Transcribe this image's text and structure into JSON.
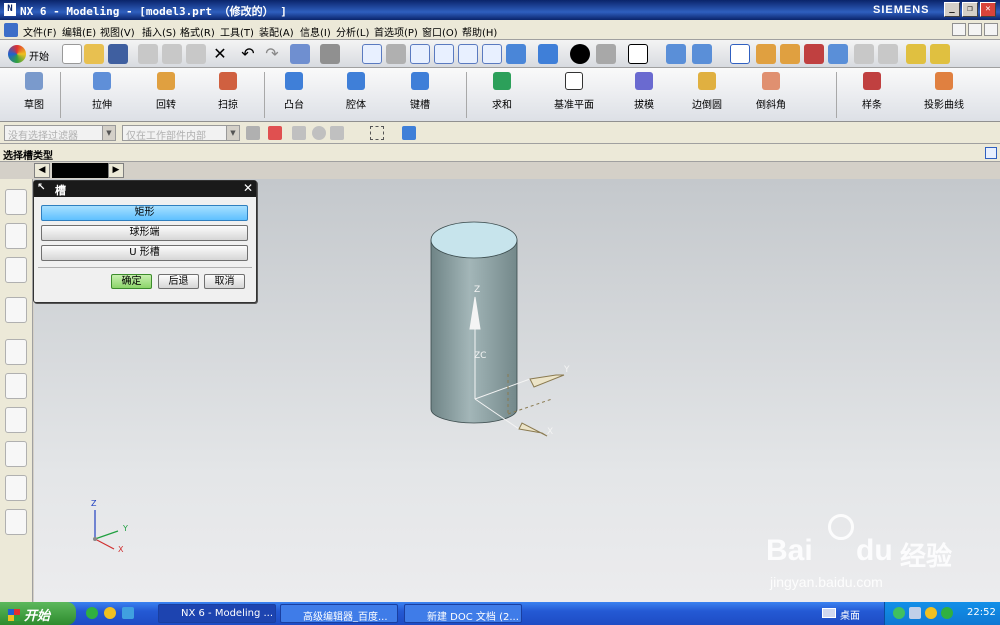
{
  "window": {
    "title": "NX 6 - Modeling - [model3.prt （修改的） ]",
    "brand": "SIEMENS",
    "min": "_",
    "max": "❐",
    "close": "✕"
  },
  "menu": [
    "文件(F)",
    "编辑(E)",
    "视图(V)",
    "插入(S)",
    "格式(R)",
    "工具(T)",
    "装配(A)",
    "信息(I)",
    "分析(L)",
    "首选项(P)",
    "窗口(O)",
    "帮助(H)"
  ],
  "toolbar": {
    "start_label": "开始"
  },
  "features": [
    {
      "label": "草图",
      "icon": "sketch-icon",
      "color": "#7a9acc"
    },
    {
      "label": "拉伸",
      "icon": "extrude-icon",
      "color": "#5f8fd8"
    },
    {
      "label": "回转",
      "icon": "revolve-icon",
      "color": "#e0a040"
    },
    {
      "label": "扫掠",
      "icon": "sweep-icon",
      "color": "#d06040"
    },
    {
      "label": "凸台",
      "icon": "boss-icon",
      "color": "#3f7fd8"
    },
    {
      "label": "腔体",
      "icon": "pocket-icon",
      "color": "#3f7fd8"
    },
    {
      "label": "键槽",
      "icon": "slot-icon",
      "color": "#3f7fd8"
    },
    {
      "label": "求和",
      "icon": "unite-icon",
      "color": "#2ca05a"
    },
    {
      "label": "基准平面",
      "icon": "datum-plane-icon",
      "color": "#ffffff"
    },
    {
      "label": "拔模",
      "icon": "draft-icon",
      "color": "#6a6ad0"
    },
    {
      "label": "边倒圆",
      "icon": "edge-blend-icon",
      "color": "#e0b040"
    },
    {
      "label": "倒斜角",
      "icon": "chamfer-icon",
      "color": "#e09070"
    },
    {
      "label": "样条",
      "icon": "spline-icon",
      "color": "#c04040"
    },
    {
      "label": "投影曲线",
      "icon": "project-curve-icon",
      "color": "#e08040"
    }
  ],
  "selection": {
    "filter": "没有选择过滤器",
    "scope": "仅在工作部件内部"
  },
  "cue": "选择槽类型",
  "dialog": {
    "title": "槽",
    "options": [
      "矩形",
      "球形端",
      "U 形槽"
    ],
    "ok": "确定",
    "back": "后退",
    "cancel": "取消"
  },
  "viewport": {
    "axes": {
      "z": "Z",
      "zc": "ZC",
      "y": "Y",
      "x": "X"
    },
    "triad": {
      "z": "Z",
      "y": "Y",
      "x": "X"
    }
  },
  "watermark": {
    "brand": "Bai",
    "brand2": "du",
    "cn": "经验",
    "url": "jingyan.baidu.com"
  },
  "taskbar": {
    "start": "开始",
    "items": [
      "NX 6 - Modeling ...",
      "高级编辑器_百度...",
      "新建 DOC 文档 (2..."
    ],
    "desktop": "桌面",
    "clock": "22:52"
  },
  "colors": {
    "titlebar": "#0a246a",
    "selected_option": "#5fc0ff",
    "cylinder": "#8fa3a5",
    "ok_button": "#8cd46a"
  }
}
